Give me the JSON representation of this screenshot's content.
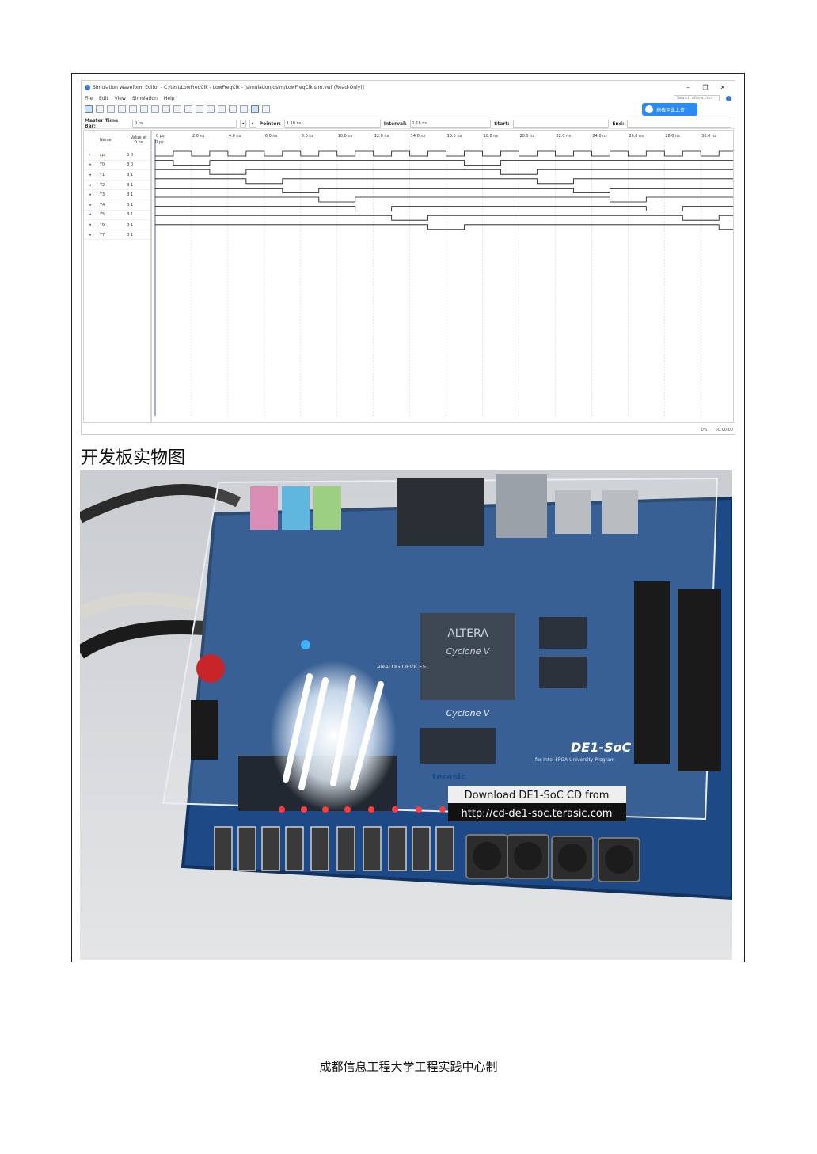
{
  "window": {
    "title": "Simulation Waveform Editor - C:/test/LowFreqClk - LowFreqClk - [simulation/qsim/LowFreqClk.sim.vwf (Read-Only)]",
    "controls": [
      "–",
      "❐",
      "✕"
    ],
    "search_placeholder": "Search altera.com",
    "menu": [
      "File",
      "Edit",
      "View",
      "Simulation",
      "Help"
    ],
    "cloud_button_label": "拖拽至此上传",
    "master_time_bar_label": "Master Time Bar:",
    "master_time_bar_value": "0 ps",
    "pointer_label": "Pointer:",
    "pointer_value": "1.18 ns",
    "interval_label": "Interval:",
    "interval_value": "1.18 ns",
    "start_label": "Start:",
    "end_label": "End:",
    "col_name": "Name",
    "col_value": "Value at\n0 ps",
    "time_ticks": [
      "0 ps",
      "2.0 ns",
      "4.0 ns",
      "6.0 ns",
      "8.0 ns",
      "10.0 ns",
      "12.0 ns",
      "14.0 ns",
      "16.0 ns",
      "18.0 ns",
      "20.0 ns",
      "22.0 ns",
      "24.0 ns",
      "26.0 ns",
      "28.0 ns",
      "30.0 ns"
    ],
    "cursor_label": "0 ps",
    "signals": [
      {
        "name": "cp",
        "value": "B 0"
      },
      {
        "name": "Y0",
        "value": "B 0"
      },
      {
        "name": "Y1",
        "value": "B 1"
      },
      {
        "name": "Y2",
        "value": "B 1"
      },
      {
        "name": "Y3",
        "value": "B 1"
      },
      {
        "name": "Y4",
        "value": "B 1"
      },
      {
        "name": "Y5",
        "value": "B 1"
      },
      {
        "name": "Y6",
        "value": "B 1"
      },
      {
        "name": "Y7",
        "value": "B 1"
      }
    ],
    "status_percent": "0%",
    "status_time": "00:00:00"
  },
  "caption": "开发板实物图",
  "photo": {
    "download_line1": "Download DE1-SoC CD from",
    "download_line2": "http://cd-de1-soc.terasic.com",
    "chip_brand": "ALTERA",
    "chip_name": "Cyclone V",
    "board_name": "DE1-SoC",
    "board_sub": "for Intel FPGA University Program",
    "vendor": "terasic",
    "adi": "ANALOG DEVICES"
  },
  "footer": "成都信息工程大学工程实践中心制"
}
